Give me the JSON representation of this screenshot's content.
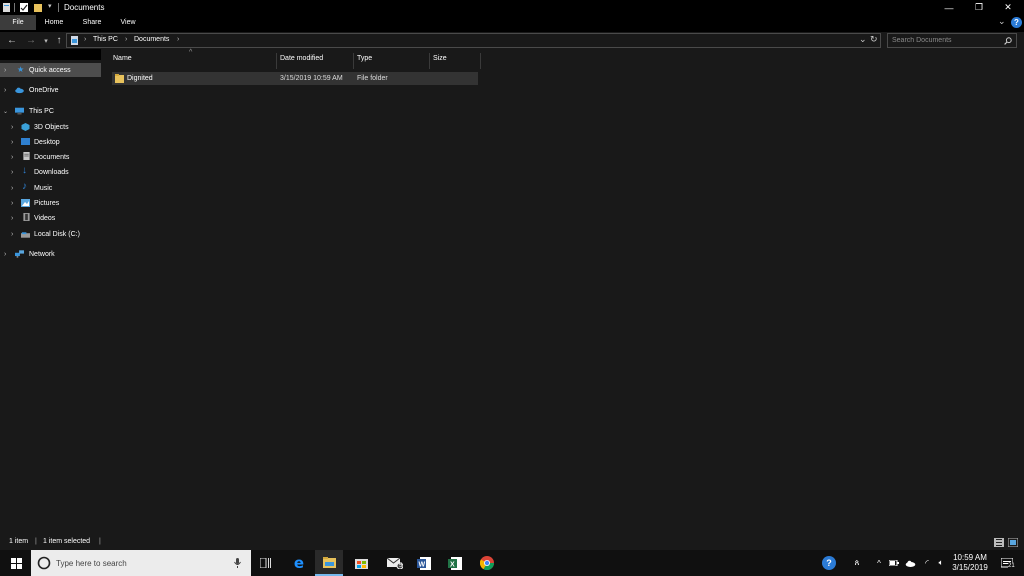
{
  "window": {
    "title": "Documents",
    "controls": {
      "minimize": "—",
      "restore": "❐",
      "close": "✕"
    }
  },
  "ribbon": {
    "tabs": [
      "File",
      "Home",
      "Share",
      "View"
    ],
    "expand": "⌄",
    "help": "?"
  },
  "address": {
    "segments": [
      "This PC",
      "Documents"
    ],
    "separator": "›",
    "refresh": "↻",
    "dropdown": "⌄"
  },
  "search": {
    "placeholder": "Search Documents",
    "icon": "search-icon"
  },
  "nav": {
    "items": [
      {
        "label": "Quick access",
        "icon": "star-icon",
        "color": "#3a96dd"
      },
      {
        "label": "OneDrive",
        "icon": "cloud-icon",
        "color": "#3a96dd"
      },
      {
        "label": "This PC",
        "icon": "monitor-icon",
        "color": "#3a96dd"
      },
      {
        "label": "3D Objects",
        "icon": "cube-icon",
        "color": "#3aa0d8"
      },
      {
        "label": "Desktop",
        "icon": "desktop-icon",
        "color": "#2f80d0"
      },
      {
        "label": "Documents",
        "icon": "document-icon",
        "color": "#c8c8c8"
      },
      {
        "label": "Downloads",
        "icon": "download-icon",
        "color": "#2f80d0"
      },
      {
        "label": "Music",
        "icon": "music-icon",
        "color": "#2f80d0"
      },
      {
        "label": "Pictures",
        "icon": "picture-icon",
        "color": "#5aa7e0"
      },
      {
        "label": "Videos",
        "icon": "video-icon",
        "color": "#9a9a9a"
      },
      {
        "label": "Local Disk (C:)",
        "icon": "drive-icon",
        "color": "#9a9a9a"
      },
      {
        "label": "Network",
        "icon": "network-icon",
        "color": "#3a96dd"
      }
    ]
  },
  "columns": [
    "Name",
    "Date modified",
    "Type",
    "Size"
  ],
  "files": [
    {
      "name": "Dignited",
      "date": "3/15/2019 10:59 AM",
      "type": "File folder",
      "size": ""
    }
  ],
  "status": {
    "count": "1 item",
    "selected": "1 item selected",
    "sep": "|"
  },
  "taskbar": {
    "search_placeholder": "Type here to search",
    "time": "10:59 AM",
    "date": "3/15/2019",
    "notifications": "21",
    "badge": "5"
  },
  "colors": {
    "accent": "#0078d7",
    "folder": "#e8c25c",
    "selected_row": "#333333",
    "pane": "#191919"
  }
}
